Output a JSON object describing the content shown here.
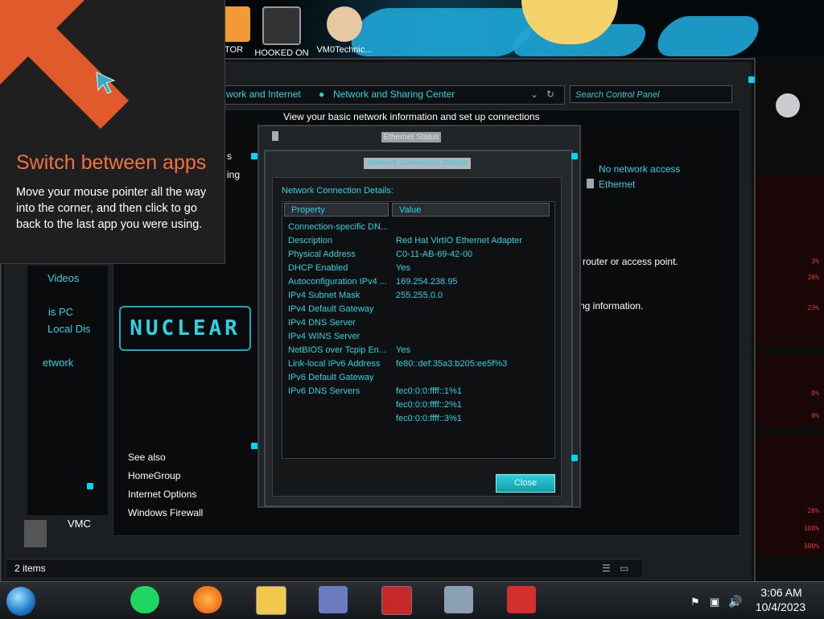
{
  "colors": {
    "accent": "#29d3e3",
    "tip_title": "#f07142",
    "gadget_red": "#e53935"
  },
  "desktop_icons": [
    {
      "label": "ITOR",
      "icon": "monitor-icon"
    },
    {
      "label": "HOOKED ON",
      "icon": "game-icon"
    },
    {
      "label": "VM0Technic...",
      "icon": "doctor-icon"
    }
  ],
  "tip": {
    "title": "Switch between apps",
    "body": "Move your mouse pointer all the way into the corner, and then click to go back to the last app you were using."
  },
  "explorer": {
    "breadcrumb_part1": "work and Internet",
    "breadcrumb_part2": "Network and Sharing Center",
    "search_placeholder": "Search Control Panel",
    "heading": "View your basic network information and set up connections",
    "network_access": "No network access",
    "ethernet_link": "Ethernet",
    "router_text": "a router or access point.",
    "info_text": "ting information.",
    "left_partial_1": "s",
    "left_partial_2": "ing",
    "see_also": "See also",
    "side_links": [
      "HomeGroup",
      "Internet Options",
      "Windows Firewall"
    ],
    "nav": [
      "Videos",
      "is PC",
      "Local Dis",
      "etwork"
    ],
    "nav_extra": "VMC",
    "status_items": "2 items",
    "brand": "NUCLEAR"
  },
  "ethernet_status": {
    "title": "Ethernet Status"
  },
  "details_dialog": {
    "title": "Network Connection Details",
    "label": "Network Connection Details:",
    "columns": [
      "Property",
      "Value"
    ],
    "rows": [
      {
        "property": "Connection-specific DN...",
        "value": ""
      },
      {
        "property": "Description",
        "value": "Red Hat VirtIO Ethernet Adapter"
      },
      {
        "property": "Physical Address",
        "value": "C0-11-AB-69-42-00"
      },
      {
        "property": "DHCP Enabled",
        "value": "Yes"
      },
      {
        "property": "Autoconfiguration IPv4 ...",
        "value": "169.254.238.95"
      },
      {
        "property": "IPv4 Subnet Mask",
        "value": "255.255.0.0"
      },
      {
        "property": "IPv4 Default Gateway",
        "value": ""
      },
      {
        "property": "IPv4 DNS Server",
        "value": ""
      },
      {
        "property": "IPv4 WINS Server",
        "value": ""
      },
      {
        "property": "NetBIOS over Tcpip En...",
        "value": "Yes"
      },
      {
        "property": "Link-local IPv6 Address",
        "value": "fe80::def:35a3:b205:ee5f%3"
      },
      {
        "property": "IPv6 Default Gateway",
        "value": ""
      },
      {
        "property": "IPv6 DNS Servers",
        "value": "fec0:0:0:ffff::1%1"
      },
      {
        "property": "",
        "value": "fec0:0:0:ffff::2%1"
      },
      {
        "property": "",
        "value": "fec0:0:0:ffff::3%1"
      }
    ],
    "close_label": "Close"
  },
  "gadget": {
    "readouts": [
      "3%",
      "26%",
      "23%",
      "0%",
      "0%",
      "26%",
      "100%",
      "100%"
    ]
  },
  "taskbar": {
    "apps": [
      "start-orb-icon",
      "spotify-icon",
      "firefox-icon",
      "file-explorer-icon",
      "control-panel-icon",
      "game-icon",
      "network-monitor-icon",
      "news-icon"
    ],
    "time": "3:06 AM",
    "date": "10/4/2023"
  }
}
